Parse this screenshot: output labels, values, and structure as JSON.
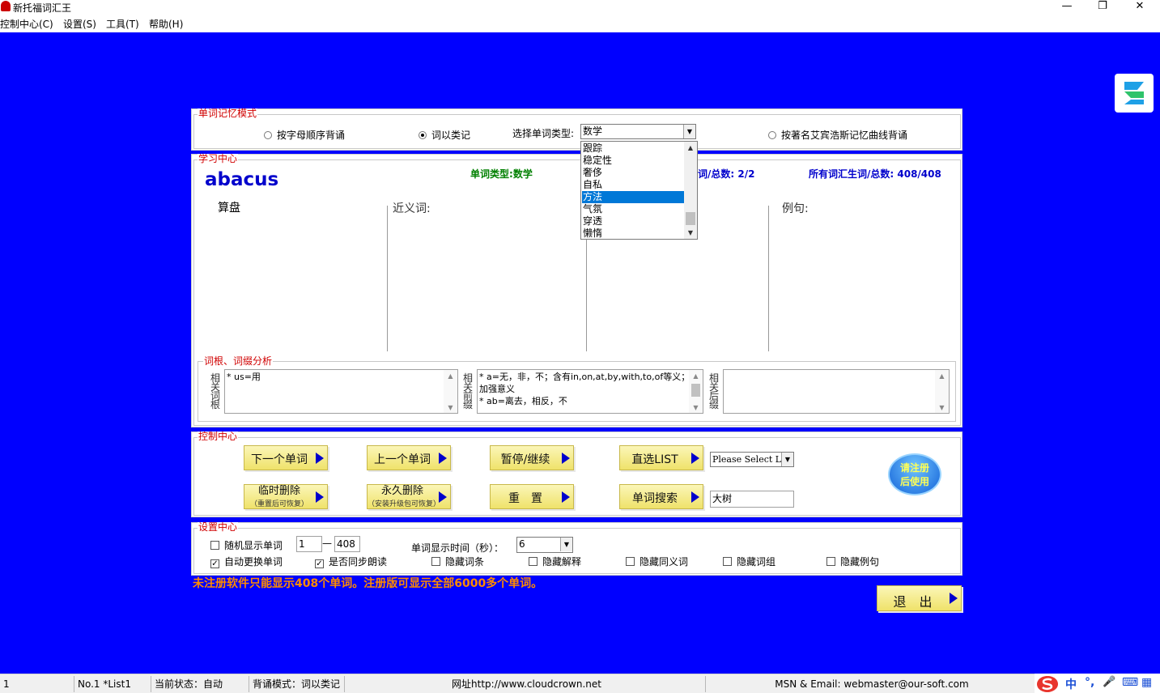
{
  "window": {
    "title": "新托福词汇王",
    "minimize": "—",
    "restore": "❐",
    "close": "✕"
  },
  "menu": [
    "控制中心(C)",
    "设置(S)",
    "工具(T)",
    "帮助(H)"
  ],
  "memory_mode": {
    "legend": "单词记忆模式",
    "option_alpha": "按字母顺序背诵",
    "option_category": "词以类记",
    "select_label": "选择单词类型:",
    "select_value": "数学",
    "option_curve": "按著名艾宾浩斯记忆曲线背诵",
    "dropdown_items": [
      "跟踪",
      "稳定性",
      "奢侈",
      "自私",
      "方法",
      "气氛",
      "穿透",
      "懒惰"
    ],
    "dropdown_selected": "方法"
  },
  "study": {
    "legend": "学习中心",
    "word": "abacus",
    "meaning": "算盘",
    "word_type_label": "单词类型:",
    "word_type_value": "数学",
    "count_label": "词/总数:",
    "count_value": "2/2",
    "total_label": "所有词汇生词/总数:",
    "total_value": "408/408",
    "synonym_label": "近义词:",
    "example_label": "例句:"
  },
  "root_analysis": {
    "legend": "词根、词缀分析",
    "root_label": "相关词根",
    "root_text": "* us=用",
    "prefix_label": "相关前缀",
    "prefix_text_1": "* a=无，非，不；含有in,on,at,by,with,to,of等义；",
    "prefix_text_2": "加强意义",
    "prefix_text_3": "* ab=离去，相反，不",
    "suffix_label": "相关后缀",
    "suffix_text": ""
  },
  "control": {
    "legend": "控制中心",
    "next": "下一个单词",
    "prev": "上一个单词",
    "pause": "暂停/继续",
    "list": "直选LIST",
    "list_select": "Please Select List",
    "temp_delete": "临时删除",
    "temp_delete_sub": "（重置后可恢复）",
    "perm_delete": "永久删除",
    "perm_delete_sub": "（安装升级包可恢复）",
    "reset": "重　置",
    "search": "单词搜索",
    "search_value": "大树",
    "register_1": "请注册",
    "register_2": "后使用"
  },
  "settings": {
    "legend": "设置中心",
    "random": "随机显示单词",
    "range_from": "1",
    "range_sep": "—",
    "range_to": "408",
    "display_time_label": "单词显示时间（秒）：",
    "display_time_value": "6",
    "auto_change": "自动更换单词",
    "sync_read": "是否同步朗读",
    "hide_entry": "隐藏词条",
    "hide_explain": "隐藏解释",
    "hide_synonym": "隐藏同义词",
    "hide_phrase": "隐藏词组",
    "hide_example": "隐藏例句"
  },
  "notice": "未注册软件只能显示408个单词。注册版可显示全部6000多个单词。",
  "exit": "退　出",
  "status": {
    "cell1": "1",
    "cell2": "No.1 *List1",
    "cell3": "当前状态：自动",
    "cell4": "背诵模式：词以类记",
    "cell5": "网址http://www.cloudcrown.net",
    "cell6": "MSN & Email: webmaster@our-soft.com"
  },
  "tray": {
    "ime": "中",
    "punct": "°,",
    "mic": "🎤",
    "keyboard": "⌨",
    "grid": "▦"
  },
  "colors": {
    "desktop": "#0000ff",
    "legend": "#d00000",
    "button": "#efe26a",
    "notice": "#ff8c00"
  }
}
